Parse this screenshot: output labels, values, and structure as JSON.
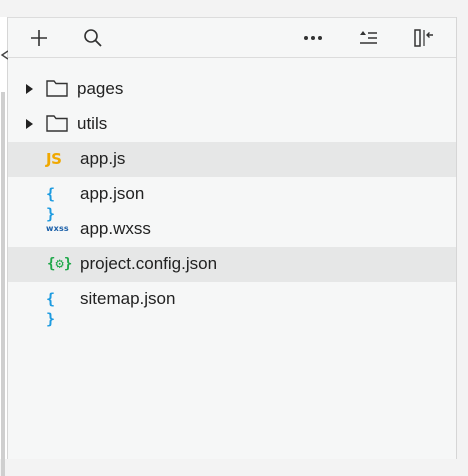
{
  "toolbar": {
    "icons": [
      "plus-icon",
      "search-icon",
      "more-icon",
      "collapse-all-icon",
      "collapse-panel-icon"
    ]
  },
  "tree": {
    "folders": [
      {
        "label": "pages"
      },
      {
        "label": "utils"
      }
    ],
    "files": [
      {
        "icon_text": "JS",
        "label": "app.js",
        "selected": true
      },
      {
        "icon_text": "{ }",
        "label": "app.json",
        "selected": false
      },
      {
        "icon_text": "wxss",
        "label": "app.wxss",
        "selected": false
      },
      {
        "icon_text": "{⚙}",
        "label": "project.config.json",
        "selected": true
      },
      {
        "icon_text": "{ }",
        "label": "sitemap.json",
        "selected": false
      }
    ]
  },
  "colors": {
    "js": "#f0a800",
    "json": "#1d9be0",
    "wxss": "#1a5fa8",
    "config": "#1fa84a",
    "selected_row": "#e6e7e7",
    "panel_bg": "#f6f7f7"
  }
}
